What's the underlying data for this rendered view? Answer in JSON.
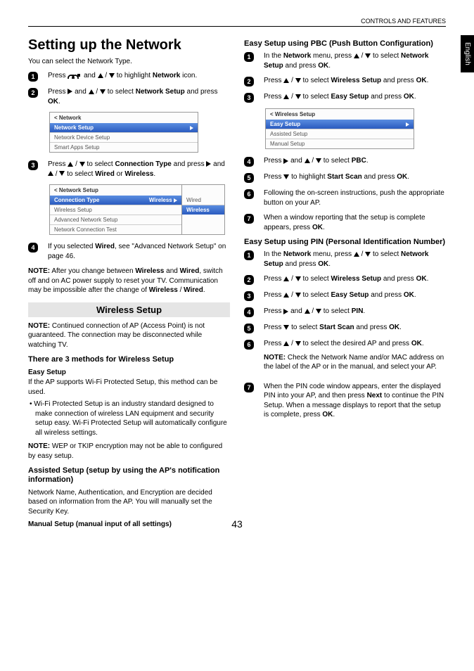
{
  "header": "CONTROLS AND FEATURES",
  "sideTab": "English",
  "pageNumber": "43",
  "left": {
    "title": "Setting up the Network",
    "intro": "You can select the Network Type.",
    "step1_a": "Press ",
    "step1_b": " and ",
    "step1_c": " to highlight ",
    "step1_network": "Network",
    "step1_d": " icon.",
    "step2_a": "Press ",
    "step2_b": " and ",
    "step2_c": " to select ",
    "step2_ns": "Network Setup",
    "step2_d": " and press ",
    "step2_ok": "OK",
    "step2_e": ".",
    "menu1_title": "< Network",
    "menu1_r1": "Network Setup",
    "menu1_r2": "Network Device Setup",
    "menu1_r3": "Smart Apps Setup",
    "step3_a": "Press ",
    "step3_b": " to select ",
    "step3_ct": "Connection Type",
    "step3_c": " and press ",
    "step3_d": " and ",
    "step3_e": " to select ",
    "step3_wired": "Wired",
    "step3_or": " or ",
    "step3_wireless": "Wireless",
    "step3_f": ".",
    "menu2_title": "< Network Setup",
    "menu2_r1": "Connection Type",
    "menu2_r1v": "Wireless",
    "menu2_r2": "Wireless Setup",
    "menu2_r3": "Advanced Network Setup",
    "menu2_r4": "Network Connection Test",
    "menu2_side1": "Wired",
    "menu2_side2": "Wireless",
    "step4_a": "If you selected ",
    "step4_wired": "Wired",
    "step4_b": ", see \"Advanced Network Setup\" on page 46.",
    "note1_head": "NOTE:",
    "note1_a": "  After you change between ",
    "note1_wireless": "Wireless",
    "note1_and": " and ",
    "note1_wired": "Wired",
    "note1_b": ", switch off and on AC power supply to reset your TV. Communication may be impossible after the change of ",
    "note1_c": " / ",
    "note1_d": ".",
    "band": "Wireless Setup",
    "note2_head": "NOTE:",
    "note2": " Continued connection of AP (Access Point) is not guaranteed. The connection may be disconnected while watching TV.",
    "sub_h": "There are 3 methods for Wireless Setup",
    "easy_h": "Easy Setup",
    "easy_body": "If the AP supports Wi-Fi Protected Setup, this method can be used.",
    "easy_bullet": "Wi-Fi Protected Setup is an industry standard designed to make connection of wireless LAN equipment and security setup easy. Wi-Fi Protected Setup will automatically configure all wireless settings.",
    "note3_head": "NOTE:",
    "note3": "  WEP or TKIP encryption may not be able to configured by easy setup.",
    "assisted_h": "Assisted Setup (setup by using the AP's notification information)",
    "assisted_body": "Network Name, Authentication, and Encryption are decided based on information from the AP. You will manually set the Security Key.",
    "manual_h": "Manual Setup (manual input of all settings)"
  },
  "right": {
    "pbc_h": "Easy Setup using PBC (Push Button Configuration)",
    "s1_a": "In the ",
    "s1_net": "Network",
    "s1_b": " menu, press ",
    "s1_c": " to select ",
    "s1_ns": "Network Setup",
    "s1_d": " and press ",
    "s1_ok": "OK",
    "s1_e": ".",
    "s2_a": "Press ",
    "s2_b": " to select ",
    "s2_ws": "Wireless Setup",
    "s2_c": " and press ",
    "s2_ok": "OK",
    "s2_d": ".",
    "s3_a": "Press ",
    "s3_b": " to select ",
    "s3_es": "Easy Setup",
    "s3_c": " and press ",
    "s3_ok": "OK",
    "s3_d": ".",
    "menu3_title": "< Wireless Setup",
    "menu3_r1": "Easy Setup",
    "menu3_r2": "Assisted Setup",
    "menu3_r3": "Manual Setup",
    "s4_a": "Press ",
    "s4_b": " and ",
    "s4_c": " to select ",
    "s4_pbc": "PBC",
    "s4_d": ".",
    "s5_a": "Press ",
    "s5_b": " to highlight ",
    "s5_ss": "Start Scan",
    "s5_c": " and press ",
    "s5_ok": "OK",
    "s5_d": ".",
    "s6": "Following the on-screen instructions, push the appropriate button on your AP.",
    "s7_a": "When a window reporting that the setup is complete appears, press ",
    "s7_ok": "OK",
    "s7_b": ".",
    "pin_h": "Easy Setup using PIN (Personal Identification Number)",
    "p1_a": "In the ",
    "p1_net": "Network",
    "p1_b": " menu, press ",
    "p1_c": " to select ",
    "p1_ns": "Network Setup",
    "p1_d": " and press ",
    "p1_ok": "OK",
    "p1_e": ".",
    "p2_a": "Press ",
    "p2_b": " to select ",
    "p2_ws": "Wireless Setup",
    "p2_c": " and press ",
    "p2_ok": "OK",
    "p2_d": ".",
    "p3_a": "Press ",
    "p3_b": " to select ",
    "p3_es": "Easy Setup",
    "p3_c": " and press ",
    "p3_ok": "OK",
    "p3_d": ".",
    "p4_a": "Press ",
    "p4_b": " and ",
    "p4_c": " to select ",
    "p4_pin": "PIN",
    "p4_d": ".",
    "p5_a": "Press ",
    "p5_b": " to select ",
    "p5_ss": "Start Scan",
    "p5_c": " and press ",
    "p5_ok": "OK",
    "p5_d": ".",
    "p6_a": "Press ",
    "p6_b": " to select the desired AP and press ",
    "p6_ok": "OK",
    "p6_c": ".",
    "p6_note_head": "NOTE:",
    "p6_note": " Check the Network Name and/or MAC address on the label of the AP or in the manual, and select your AP.",
    "p7_a": "When the PIN code window appears, enter the displayed PIN into your AP, and then press ",
    "p7_next": "Next",
    "p7_b": " to continue the PIN Setup. When a message displays to report that the setup is complete, press ",
    "p7_ok": "OK",
    "p7_c": "."
  }
}
